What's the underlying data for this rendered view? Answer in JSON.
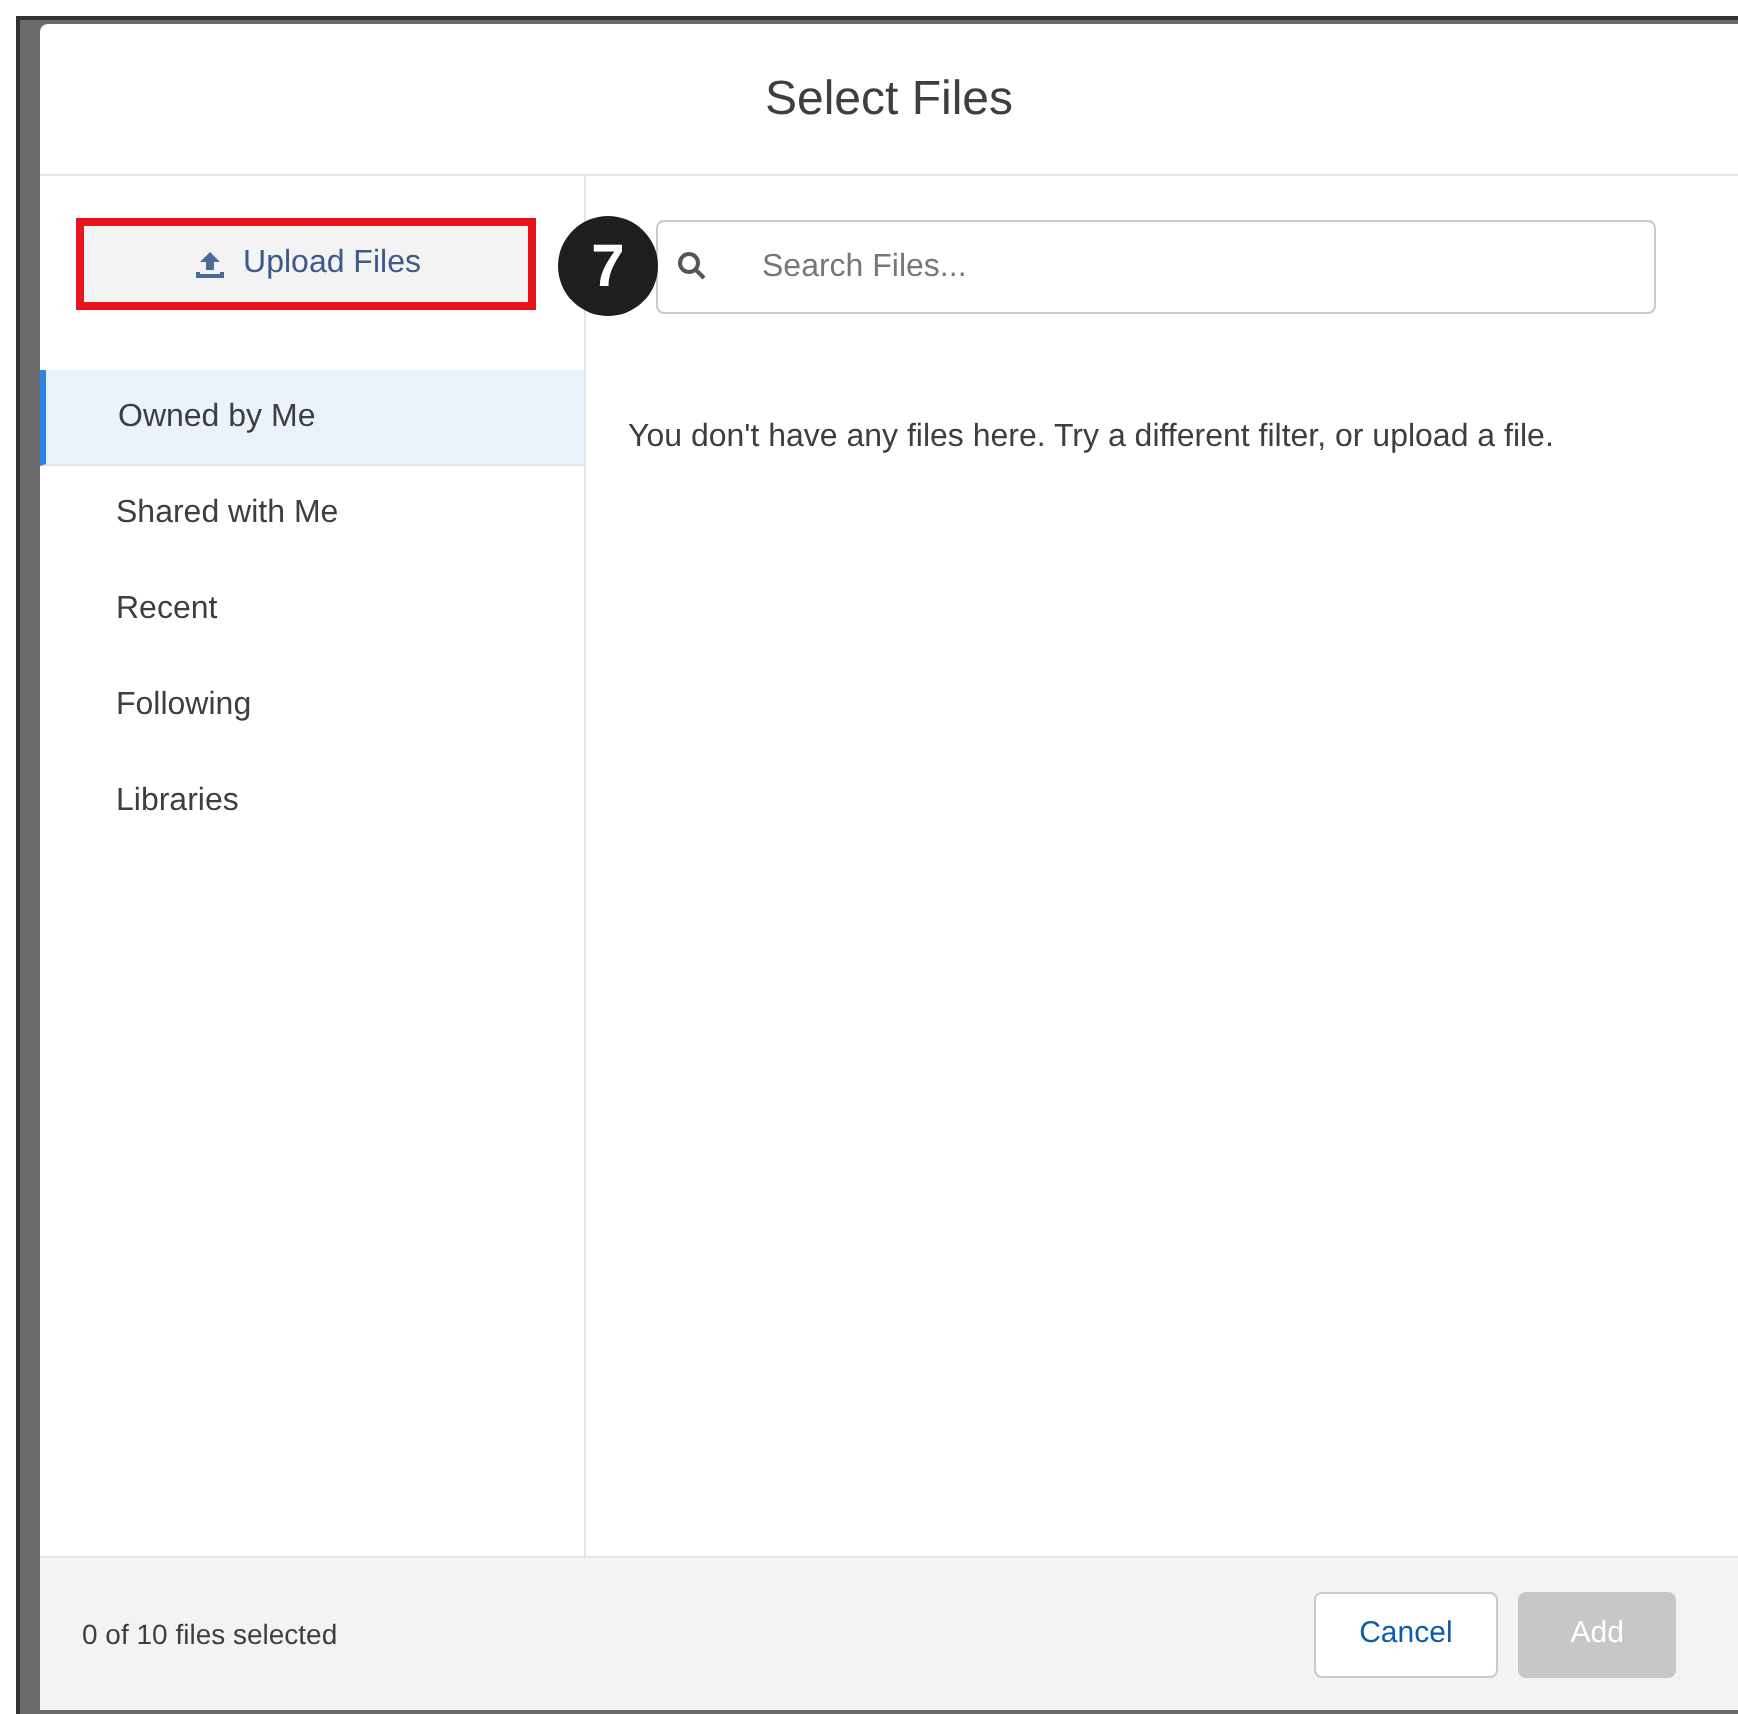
{
  "dialog": {
    "title": "Select Files"
  },
  "upload_button": {
    "label": "Upload Files"
  },
  "callout": {
    "number": "7"
  },
  "search": {
    "placeholder": "Search Files..."
  },
  "filters": [
    {
      "label": "Owned by Me",
      "selected": true
    },
    {
      "label": "Shared with Me",
      "selected": false
    },
    {
      "label": "Recent",
      "selected": false
    },
    {
      "label": "Following",
      "selected": false
    },
    {
      "label": "Libraries",
      "selected": false
    }
  ],
  "empty_message": "You don't have any files here. Try a different filter, or upload a file.",
  "footer": {
    "status": "0 of 10 files selected",
    "buttons": [
      {
        "label": "Cancel",
        "disabled": false
      },
      {
        "label": "Add",
        "disabled": true
      }
    ]
  }
}
